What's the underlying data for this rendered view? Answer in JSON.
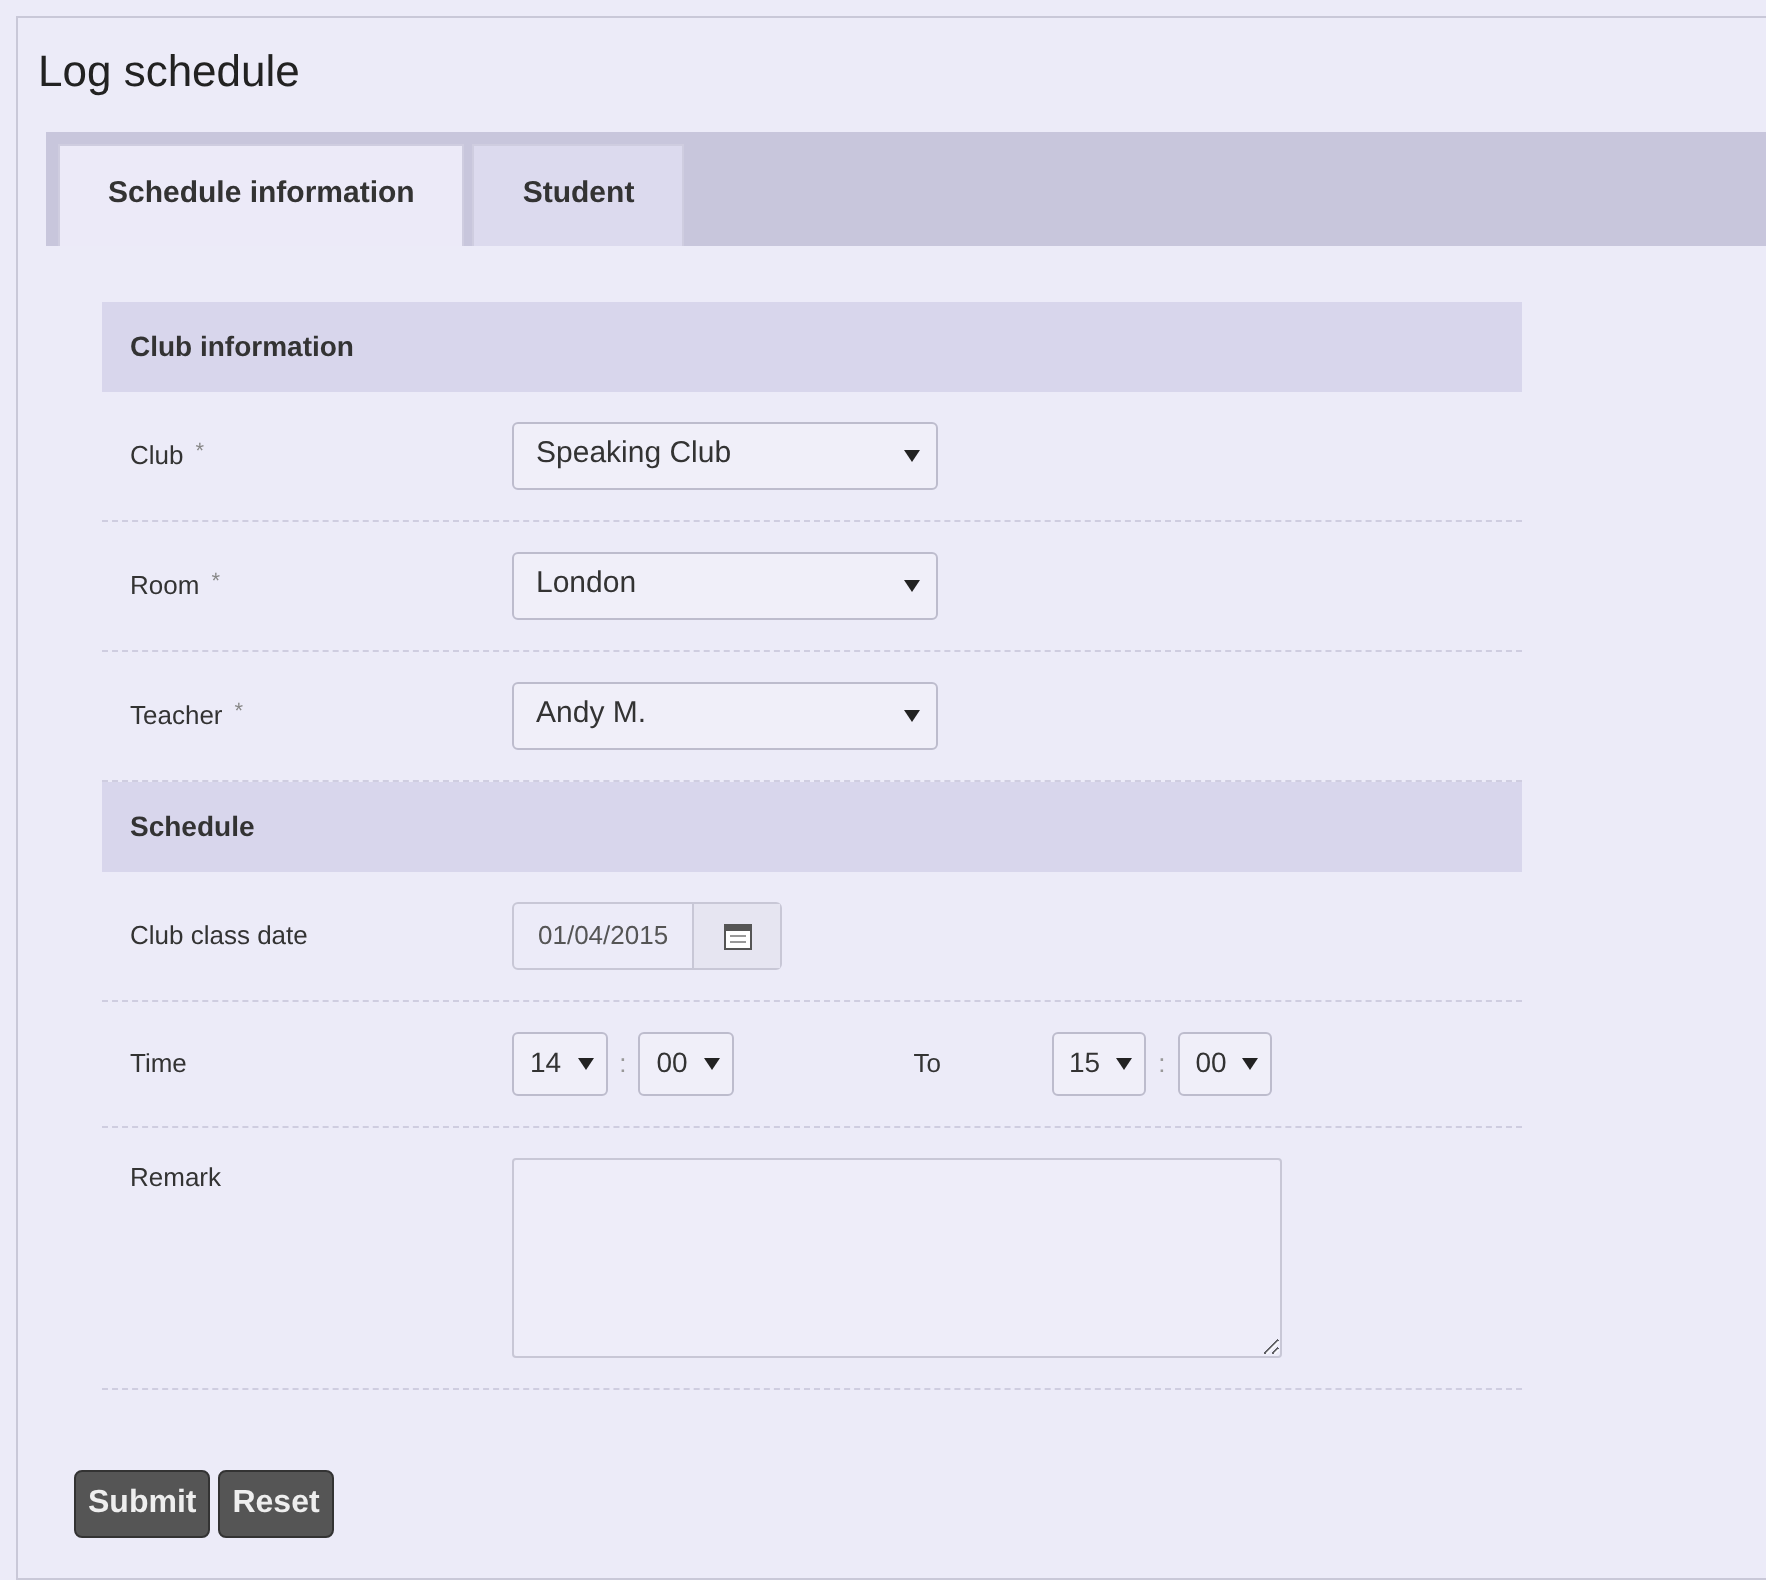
{
  "title": "Log schedule",
  "tabs": [
    {
      "label": "Schedule information",
      "selected": true
    },
    {
      "label": "Student",
      "selected": false
    }
  ],
  "sections": [
    {
      "heading": "Club information",
      "rows": [
        {
          "kind": "select",
          "label": "Club",
          "required_mark": "*",
          "value": "Speaking Club"
        },
        {
          "kind": "select",
          "label": "Room",
          "required_mark": "*",
          "value": "London"
        },
        {
          "kind": "select",
          "label": "Teacher",
          "required_mark": "*",
          "value": "Andy M."
        }
      ]
    },
    {
      "heading": "Schedule",
      "rows": [
        {
          "kind": "date",
          "label": "Club class date",
          "value": "01/04/2015"
        },
        {
          "kind": "time_range",
          "label": "Time",
          "start": {
            "hour": "14",
            "separator": ":",
            "minute": "00"
          },
          "to_label": "To",
          "end": {
            "hour": "15",
            "separator": ":",
            "minute": "00"
          }
        },
        {
          "kind": "textarea",
          "label": "Remark"
        }
      ]
    }
  ],
  "buttons": [
    "Submit",
    "Reset"
  ]
}
